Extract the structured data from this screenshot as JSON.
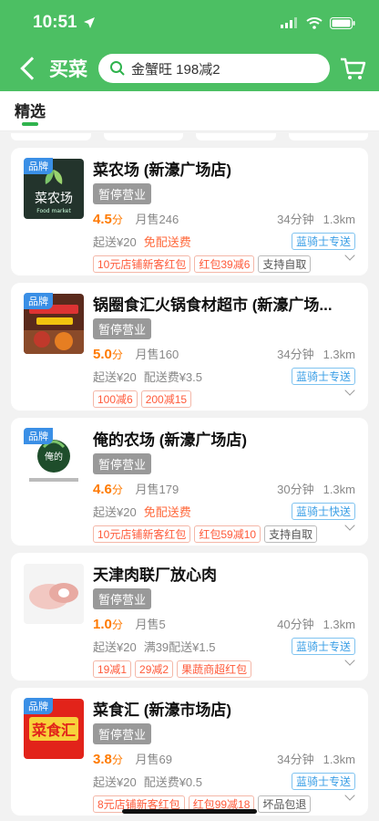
{
  "status": {
    "time": "10:51"
  },
  "nav": {
    "title": "买菜",
    "search_text": "金蟹旺 198减2"
  },
  "tabs": {
    "active": "精选"
  },
  "colors": {
    "brand": "#4cbf63",
    "accent": "#ff7a00",
    "badge": "#3a8fe6"
  },
  "stores": [
    {
      "badge": "品牌",
      "name": "菜农场 (新濠广场店)",
      "status": "暂停营业",
      "rating": "4.5",
      "rating_unit": "分",
      "sales": "月售246",
      "time": "34分钟",
      "distance": "1.3km",
      "min_order": "起送¥20",
      "fee": "免配送费",
      "delivery": "蓝骑士专送",
      "tags": [
        "10元店铺新客红包",
        "红包39减6",
        "支持自取"
      ]
    },
    {
      "badge": "品牌",
      "name": "锅圈食汇火锅食材超市 (新濠广场...",
      "status": "暂停营业",
      "rating": "5.0",
      "rating_unit": "分",
      "sales": "月售160",
      "time": "34分钟",
      "distance": "1.3km",
      "min_order": "起送¥20",
      "fee": "配送费¥3.5",
      "delivery": "蓝骑士专送",
      "tags": [
        "100减6",
        "200减15"
      ]
    },
    {
      "badge": "品牌",
      "name": "俺的农场 (新濠广场店)",
      "status": "暂停营业",
      "rating": "4.6",
      "rating_unit": "分",
      "sales": "月售179",
      "time": "30分钟",
      "distance": "1.3km",
      "min_order": "起送¥20",
      "fee": "免配送费",
      "delivery": "蓝骑士快送",
      "tags": [
        "10元店铺新客红包",
        "红包59减10",
        "支持自取"
      ]
    },
    {
      "badge": "",
      "name": "天津肉联厂放心肉",
      "status": "暂停营业",
      "rating": "1.0",
      "rating_unit": "分",
      "sales": "月售5",
      "time": "40分钟",
      "distance": "1.3km",
      "min_order": "起送¥20",
      "fee": "满39配送¥1.5",
      "delivery": "蓝骑士专送",
      "tags": [
        "19减1",
        "29减2",
        "果蔬商超红包"
      ]
    },
    {
      "badge": "品牌",
      "name": "菜食汇 (新濠市场店)",
      "status": "暂停营业",
      "rating": "3.8",
      "rating_unit": "分",
      "sales": "月售69",
      "time": "34分钟",
      "distance": "1.3km",
      "min_order": "起送¥20",
      "fee": "配送费¥0.5",
      "delivery": "蓝骑士专送",
      "tags": [
        "8元店铺新客红包",
        "红包99减18",
        "坏品包退"
      ]
    }
  ]
}
